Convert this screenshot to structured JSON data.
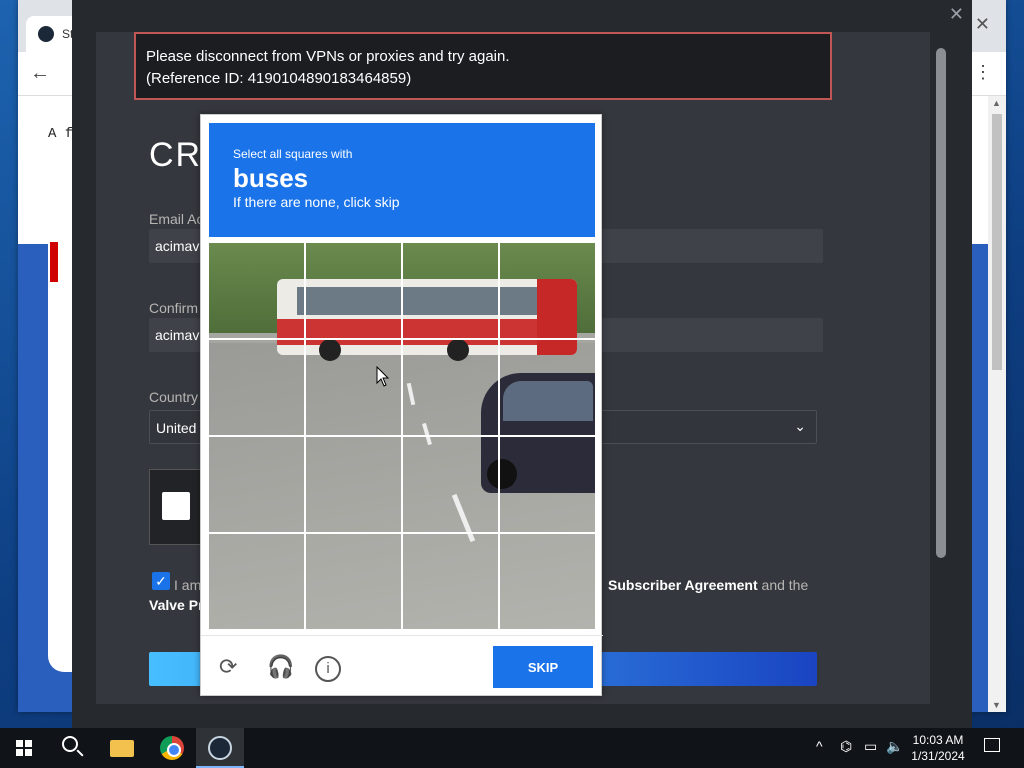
{
  "browser": {
    "tab_title": "St",
    "page_text": "A f"
  },
  "steam": {
    "error_line1": "Please disconnect from VPNs or proxies and try again.",
    "error_line2": "(Reference ID: 4190104890183464859)",
    "title": "CRI",
    "email_label": "Email Ac",
    "email_value": "acimave",
    "confirm_label": "Confirm",
    "confirm_value": "acimave",
    "country_label": "Country",
    "country_value": "United",
    "agree_prefix": "I am",
    "agree_link": "Subscriber Agreement",
    "agree_suffix": "and the",
    "agree_link2": "Valve Pr"
  },
  "challenge": {
    "line1": "Select all squares with",
    "target": "buses",
    "line3": "If there are none, click skip",
    "skip_label": "SKIP"
  },
  "taskbar": {
    "time": "10:03 AM",
    "date": "1/31/2024"
  }
}
